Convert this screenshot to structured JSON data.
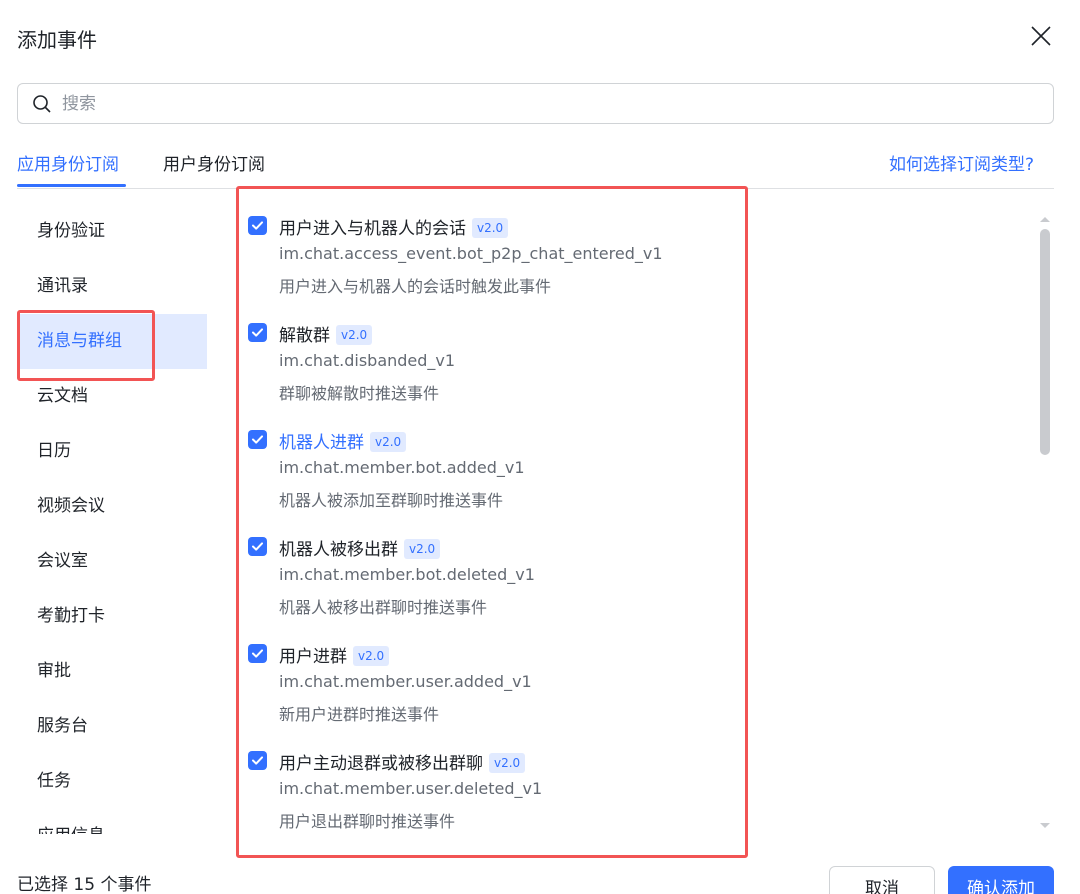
{
  "dialog": {
    "title": "添加事件"
  },
  "search": {
    "placeholder": "搜索"
  },
  "tabs": [
    {
      "label": "应用身份订阅"
    },
    {
      "label": "用户身份订阅"
    }
  ],
  "help_link": "如何选择订阅类型?",
  "sidebar": {
    "items": [
      {
        "label": "身份验证"
      },
      {
        "label": "通讯录"
      },
      {
        "label": "消息与群组"
      },
      {
        "label": "云文档"
      },
      {
        "label": "日历"
      },
      {
        "label": "视频会议"
      },
      {
        "label": "会议室"
      },
      {
        "label": "考勤打卡"
      },
      {
        "label": "审批"
      },
      {
        "label": "服务台"
      },
      {
        "label": "任务"
      },
      {
        "label": "应用信息"
      }
    ]
  },
  "events": [
    {
      "name": "用户进入与机器人的会话",
      "version": "v2.0",
      "key": "im.chat.access_event.bot_p2p_chat_entered_v1",
      "desc": "用户进入与机器人的会话时触发此事件"
    },
    {
      "name": "解散群",
      "version": "v2.0",
      "key": "im.chat.disbanded_v1",
      "desc": "群聊被解散时推送事件"
    },
    {
      "name": "机器人进群",
      "version": "v2.0",
      "key": "im.chat.member.bot.added_v1",
      "desc": "机器人被添加至群聊时推送事件"
    },
    {
      "name": "机器人被移出群",
      "version": "v2.0",
      "key": "im.chat.member.bot.deleted_v1",
      "desc": "机器人被移出群聊时推送事件"
    },
    {
      "name": "用户进群",
      "version": "v2.0",
      "key": "im.chat.member.user.added_v1",
      "desc": "新用户进群时推送事件"
    },
    {
      "name": "用户主动退群或被移出群聊",
      "version": "v2.0",
      "key": "im.chat.member.user.deleted_v1",
      "desc": "用户退出群聊时推送事件"
    }
  ],
  "footer": {
    "selected_text": "已选择 15 个事件",
    "cancel_label": "取消",
    "confirm_label": "确认添加"
  },
  "colors": {
    "accent": "#3370ff",
    "highlight": "#f25454"
  }
}
